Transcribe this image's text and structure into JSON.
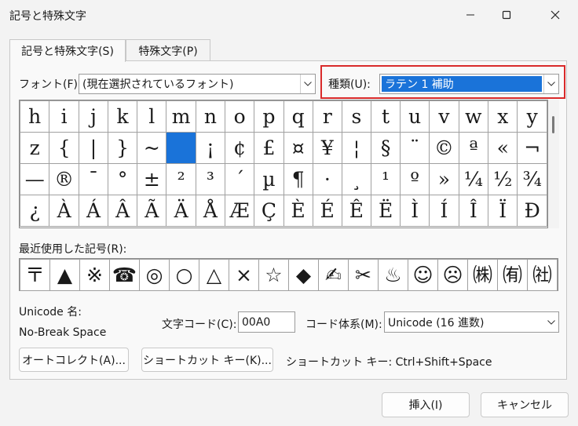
{
  "window": {
    "title": "記号と特殊文字"
  },
  "tabs": [
    {
      "label": "記号と特殊文字(S)"
    },
    {
      "label": "特殊文字(P)"
    }
  ],
  "font": {
    "label": "フォント(F):",
    "value": "(現在選択されているフォント)"
  },
  "subset": {
    "label": "種類(U):",
    "value": "ラテン 1 補助"
  },
  "grid_rows": [
    [
      "h",
      "i",
      "j",
      "k",
      "l",
      "m",
      "n",
      "o",
      "p",
      "q",
      "r",
      "s",
      "t",
      "u",
      "v",
      "w",
      "x",
      "y"
    ],
    [
      "z",
      "{",
      "|",
      "}",
      "~",
      "",
      "¡",
      "¢",
      "£",
      "¤",
      "¥",
      "¦",
      "§",
      "¨",
      "©",
      "ª",
      "«",
      "¬"
    ],
    [
      "—",
      "®",
      "¯",
      "°",
      "±",
      "²",
      "³",
      "´",
      "µ",
      "¶",
      "·",
      "¸",
      "¹",
      "º",
      "»",
      "¼",
      "½",
      "¾"
    ],
    [
      "¿",
      "À",
      "Á",
      "Â",
      "Ã",
      "Ä",
      "Å",
      "Æ",
      "Ç",
      "È",
      "É",
      "Ê",
      "Ë",
      "Ì",
      "Í",
      "Î",
      "Ï",
      "Ð"
    ]
  ],
  "selected_cell": {
    "row": 1,
    "col": 5
  },
  "recent": {
    "label": "最近使用した記号(R):",
    "symbols": [
      "〒",
      "▲",
      "※",
      "☎",
      "◎",
      "○",
      "△",
      "×",
      "☆",
      "◆",
      "✍",
      "✂",
      "♨",
      "☺",
      "☹",
      "㈱",
      "㈲",
      "㈳"
    ]
  },
  "unicode": {
    "name_label": "Unicode 名:",
    "name_value": "No-Break Space"
  },
  "charcode": {
    "label": "文字コード(C):",
    "value": "00A0"
  },
  "codesystem": {
    "label": "コード体系(M):",
    "value": "Unicode (16 進数)"
  },
  "buttons": {
    "autocorrect": "オートコレクト(A)...",
    "shortcut_key": "ショートカット キー(K)...",
    "insert": "挿入(I)",
    "cancel": "キャンセル"
  },
  "shortcut": {
    "text": "ショートカット キー: Ctrl+Shift+Space"
  },
  "colors": {
    "selection": "#1a73d9",
    "highlight_box": "#d92a2a"
  }
}
